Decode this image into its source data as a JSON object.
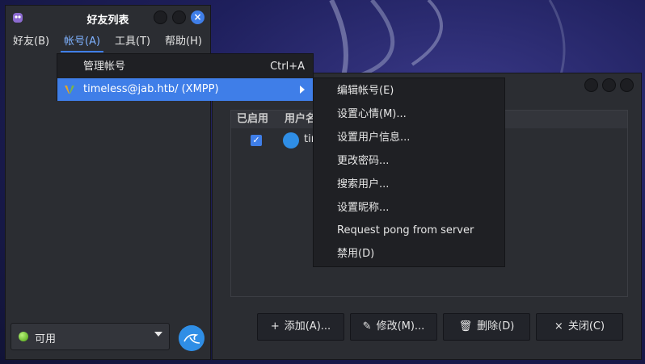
{
  "buddy_window": {
    "title": "好友列表",
    "close_glyph": "×",
    "menus": [
      {
        "label": "好友(B)"
      },
      {
        "label": "帐号(A)"
      },
      {
        "label": "工具(T)"
      },
      {
        "label": "帮助(H)"
      }
    ],
    "status": {
      "label": "可用",
      "dot_color": "#6cc521"
    }
  },
  "account_menu": {
    "manage": {
      "label": "管理帐号",
      "shortcut": "Ctrl+A"
    },
    "account": {
      "label": "timeless@jab.htb/ (XMPP)"
    }
  },
  "account_submenu": {
    "items": [
      {
        "label": "编辑帐号(E)"
      },
      {
        "label": "设置心情(M)..."
      },
      {
        "label": "设置用户信息..."
      },
      {
        "label": "更改密码..."
      },
      {
        "label": "搜索用户..."
      },
      {
        "label": "设置昵称..."
      },
      {
        "label": "Request pong from server"
      },
      {
        "label": "禁用(D)"
      }
    ]
  },
  "accounts_dialog": {
    "columns": [
      "已启用",
      "用户名"
    ],
    "rows": [
      {
        "enabled_glyph": "✓",
        "username_visible": "tin"
      }
    ],
    "buttons": [
      {
        "icon": "+",
        "label": "添加(A)..."
      },
      {
        "icon": "✎",
        "label": "修改(M)..."
      },
      {
        "icon": "🗑",
        "label": "删除(D)"
      },
      {
        "icon": "×",
        "label": "关闭(C)"
      }
    ]
  },
  "colors": {
    "accent": "#3f7ee8",
    "menu_bg": "#1f2024",
    "window_bg": "#2b2d32"
  }
}
